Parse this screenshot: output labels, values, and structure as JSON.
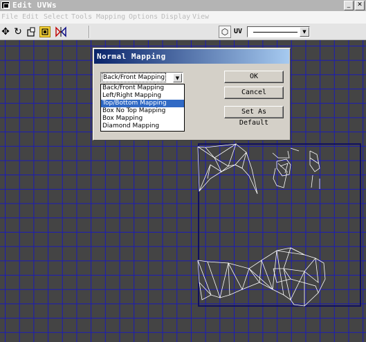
{
  "window": {
    "title": "Edit UVWs",
    "minimize_label": "_",
    "close_label": "✕"
  },
  "menu": [
    "File",
    "Edit",
    "Select",
    "Tools",
    "Mapping",
    "Options",
    "Display",
    "View"
  ],
  "toolbar": {
    "icons": [
      "move-icon",
      "rotate-icon",
      "scale-icon",
      "freeform-icon",
      "mirror-icon"
    ],
    "uv_label": "UV",
    "uv_icon": "cube-icon"
  },
  "dialog": {
    "title": "Normal Mapping",
    "selected_value": "Back/Front Mapping",
    "options": [
      "Back/Front Mapping",
      "Left/Right Mapping",
      "Top/Bottom Mapping",
      "Box No Top Mapping",
      "Box Mapping",
      "Diamond Mapping"
    ],
    "highlighted_option": "Top/Bottom Mapping",
    "buttons": {
      "ok": "OK",
      "cancel": "Cancel",
      "set_default": "Set As Default"
    }
  },
  "colors": {
    "grid_background": "#444444",
    "grid_lines": "#1b1bb8",
    "uv_bounds": "#101060",
    "mesh": "#ffffff",
    "dialog_title_start": "#0a246a",
    "dialog_title_end": "#a6caf0",
    "highlight": "#316ac5"
  }
}
